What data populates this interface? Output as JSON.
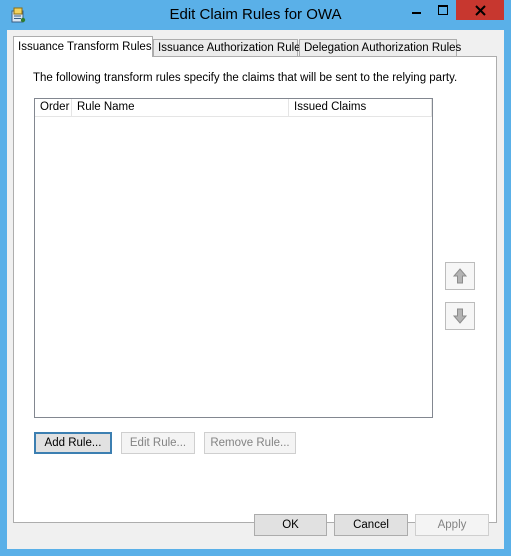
{
  "window": {
    "title": "Edit Claim Rules for OWA",
    "app_icon": "claim-rules-icon",
    "controls": {
      "minimize": "minimize-icon",
      "maximize": "maximize-icon",
      "close": "close-icon"
    },
    "colors": {
      "titlebar": "#5ab0e8",
      "close": "#c7372f"
    }
  },
  "tabs": [
    {
      "label": "Issuance Transform Rules",
      "active": true
    },
    {
      "label": "Issuance Authorization Rules",
      "active": false
    },
    {
      "label": "Delegation Authorization Rules",
      "active": false
    }
  ],
  "panel": {
    "description": "The following transform rules specify the claims that will be sent to the relying party.",
    "columns": [
      "Order",
      "Rule Name",
      "Issued Claims"
    ],
    "rows": [],
    "side_buttons": {
      "up": "arrow-up-icon",
      "down": "arrow-down-icon"
    },
    "buttons": {
      "add": "Add Rule...",
      "edit": "Edit Rule...",
      "remove": "Remove Rule..."
    }
  },
  "footer": {
    "ok": "OK",
    "cancel": "Cancel",
    "apply": "Apply"
  }
}
